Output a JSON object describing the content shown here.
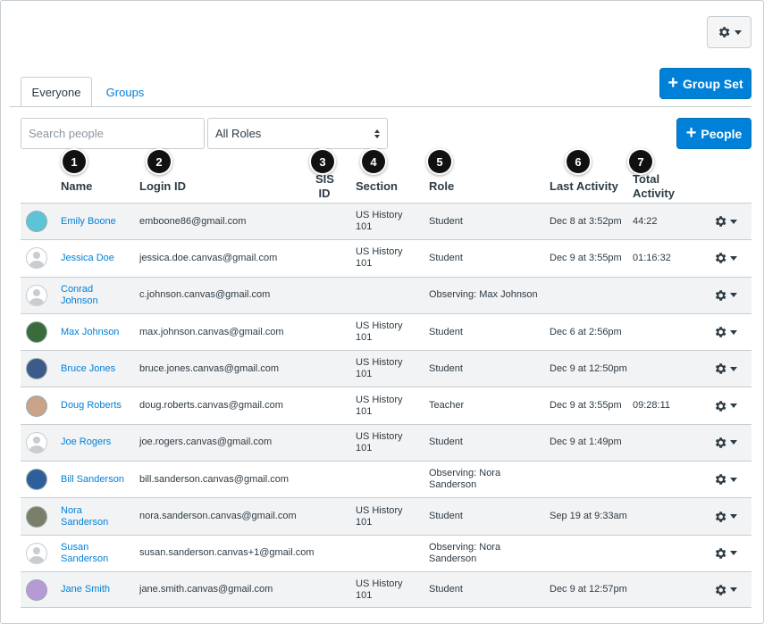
{
  "toolbar": {
    "gear_icon": "gear-icon",
    "group_set_label": "Group Set",
    "people_label": "People"
  },
  "tabs": [
    {
      "label": "Everyone",
      "active": true
    },
    {
      "label": "Groups",
      "active": false
    }
  ],
  "search": {
    "placeholder": "Search people",
    "value": ""
  },
  "role_filter": {
    "selected": "All Roles"
  },
  "callouts": [
    "1",
    "2",
    "3",
    "4",
    "5",
    "6",
    "7"
  ],
  "columns": {
    "name": "Name",
    "login_id": "Login ID",
    "sis_id_1": "SIS",
    "sis_id_2": "ID",
    "section": "Section",
    "role": "Role",
    "last_activity": "Last Activity",
    "total_activity_1": "Total",
    "total_activity_2": "Activity"
  },
  "rows": [
    {
      "name": "Emily Boone",
      "login": "emboone86@gmail.com",
      "section": "US History 101",
      "role": "Student",
      "last_activity": "Dec 8 at 3:52pm",
      "total": "44:22",
      "avatar_color": "#5bc4d6"
    },
    {
      "name": "Jessica Doe",
      "login": "jessica.doe.canvas@gmail.com",
      "section": "US History 101",
      "role": "Student",
      "last_activity": "Dec 9 at 3:55pm",
      "total": "01:16:32",
      "avatar_color": ""
    },
    {
      "name": "Conrad Johnson",
      "login": "c.johnson.canvas@gmail.com",
      "section": "",
      "role": "Observing: Max Johnson",
      "last_activity": "",
      "total": "",
      "avatar_color": ""
    },
    {
      "name": "Max Johnson",
      "login": "max.johnson.canvas@gmail.com",
      "section": "US History 101",
      "role": "Student",
      "last_activity": "Dec 6 at 2:56pm",
      "total": "",
      "avatar_color": "#3a6b3a"
    },
    {
      "name": "Bruce Jones",
      "login": "bruce.jones.canvas@gmail.com",
      "section": "US History 101",
      "role": "Student",
      "last_activity": "Dec 9 at 12:50pm",
      "total": "",
      "avatar_color": "#3c5a8a"
    },
    {
      "name": "Doug Roberts",
      "login": "doug.roberts.canvas@gmail.com",
      "section": "US History 101",
      "role": "Teacher",
      "last_activity": "Dec 9 at 3:55pm",
      "total": "09:28:11",
      "avatar_color": "#c9a38a"
    },
    {
      "name": "Joe Rogers",
      "login": "joe.rogers.canvas@gmail.com",
      "section": "US History 101",
      "role": "Student",
      "last_activity": "Dec 9 at 1:49pm",
      "total": "",
      "avatar_color": ""
    },
    {
      "name": "Bill Sanderson",
      "login": "bill.sanderson.canvas@gmail.com",
      "section": "",
      "role": "Observing: Nora Sanderson",
      "last_activity": "",
      "total": "",
      "avatar_color": "#2f5f9a"
    },
    {
      "name": "Nora Sanderson",
      "login": "nora.sanderson.canvas@gmail.com",
      "section": "US History 101",
      "role": "Student",
      "last_activity": "Sep 19 at 9:33am",
      "total": "",
      "avatar_color": "#7a7f6a"
    },
    {
      "name": "Susan Sanderson",
      "login": "susan.sanderson.canvas+1@gmail.com",
      "section": "",
      "role": "Observing: Nora Sanderson",
      "last_activity": "",
      "total": "",
      "avatar_color": ""
    },
    {
      "name": "Jane Smith",
      "login": "jane.smith.canvas@gmail.com",
      "section": "US History 101",
      "role": "Student",
      "last_activity": "Dec 9 at 12:57pm",
      "total": "",
      "avatar_color": "#b69ad6"
    }
  ]
}
